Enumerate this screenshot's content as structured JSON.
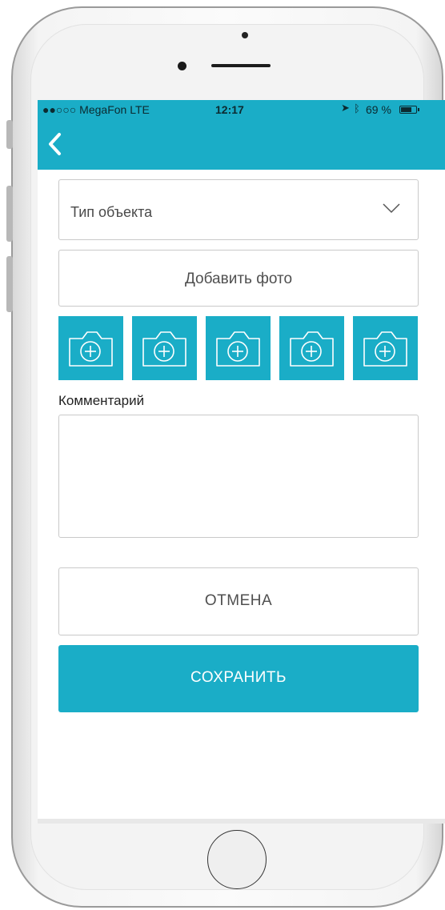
{
  "status_bar": {
    "carrier": "●●○○○ MegaFon  LTE",
    "time": "12:17",
    "battery": "69 %"
  },
  "nav": {
    "back_icon": "chevron-left-icon"
  },
  "form": {
    "object_type_placeholder": "Тип объекта",
    "add_photo_label": "Добавить фото",
    "photo_slots": 5,
    "comment_label": "Комментарий",
    "comment_value": "",
    "cancel_label": "ОТМЕНА",
    "save_label": "СОХРАНИТЬ"
  },
  "colors": {
    "accent": "#1aadc7",
    "border": "#c9c9c9"
  }
}
